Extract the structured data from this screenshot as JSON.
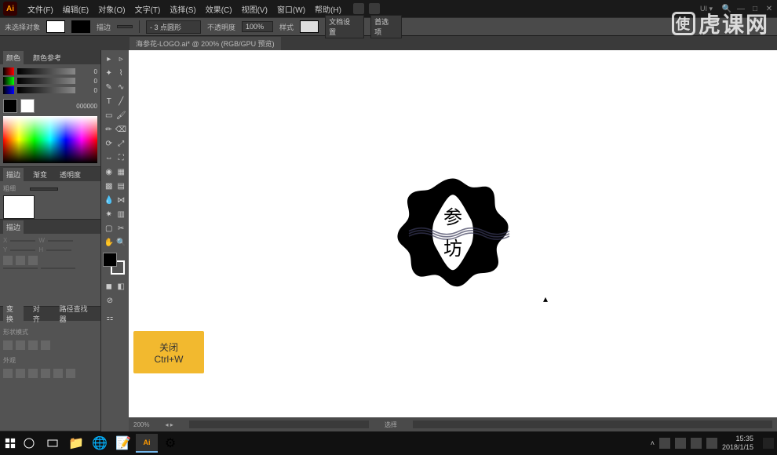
{
  "app": {
    "icon_label": "Ai"
  },
  "menu": {
    "file": "文件(F)",
    "edit": "编辑(E)",
    "object": "对象(O)",
    "type": "文字(T)",
    "select": "选择(S)",
    "effect": "效果(C)",
    "view": "视图(V)",
    "window": "窗口(W)",
    "help": "帮助(H)"
  },
  "options": {
    "no_selection": "未选择对象",
    "stroke_label": "描边",
    "stroke_value": "",
    "point_value": "- 3 点圆形",
    "opacity_label": "不透明度",
    "opacity_value": "100%",
    "style_label": "样式",
    "doc_setup": "文档设置",
    "preferences": "首选项"
  },
  "document": {
    "tab_label": "海参花-LOGO.ai* @ 200% (RGB/GPU 预览)"
  },
  "panels": {
    "color": {
      "tab1": "颜色",
      "tab2": "颜色参考",
      "r": "0",
      "g": "0",
      "b": "0",
      "hex": "000000"
    },
    "brush": {
      "tab1": "描边",
      "tab2": "渐变",
      "tab3": "透明度",
      "label": "粗细"
    },
    "stroke": {
      "tab": "描边"
    },
    "transform": {
      "tab1": "变换",
      "tab2": "对齐",
      "tab3": "路径查找器",
      "shape_mode": "形状模式",
      "pathfinder": "外观"
    }
  },
  "tooltip": {
    "title": "关闭",
    "shortcut": "Ctrl+W"
  },
  "status": {
    "zoom": "200%",
    "tool": "选择"
  },
  "win": {
    "ui": "UI ▾",
    "min": "—",
    "max": "□",
    "close": "✕"
  },
  "taskbar": {
    "time": "15:35",
    "date": "2018/1/15"
  },
  "watermark": {
    "text": "虎课网",
    "icon": "使"
  },
  "logo": {
    "char1": "参",
    "char2": "坊"
  }
}
